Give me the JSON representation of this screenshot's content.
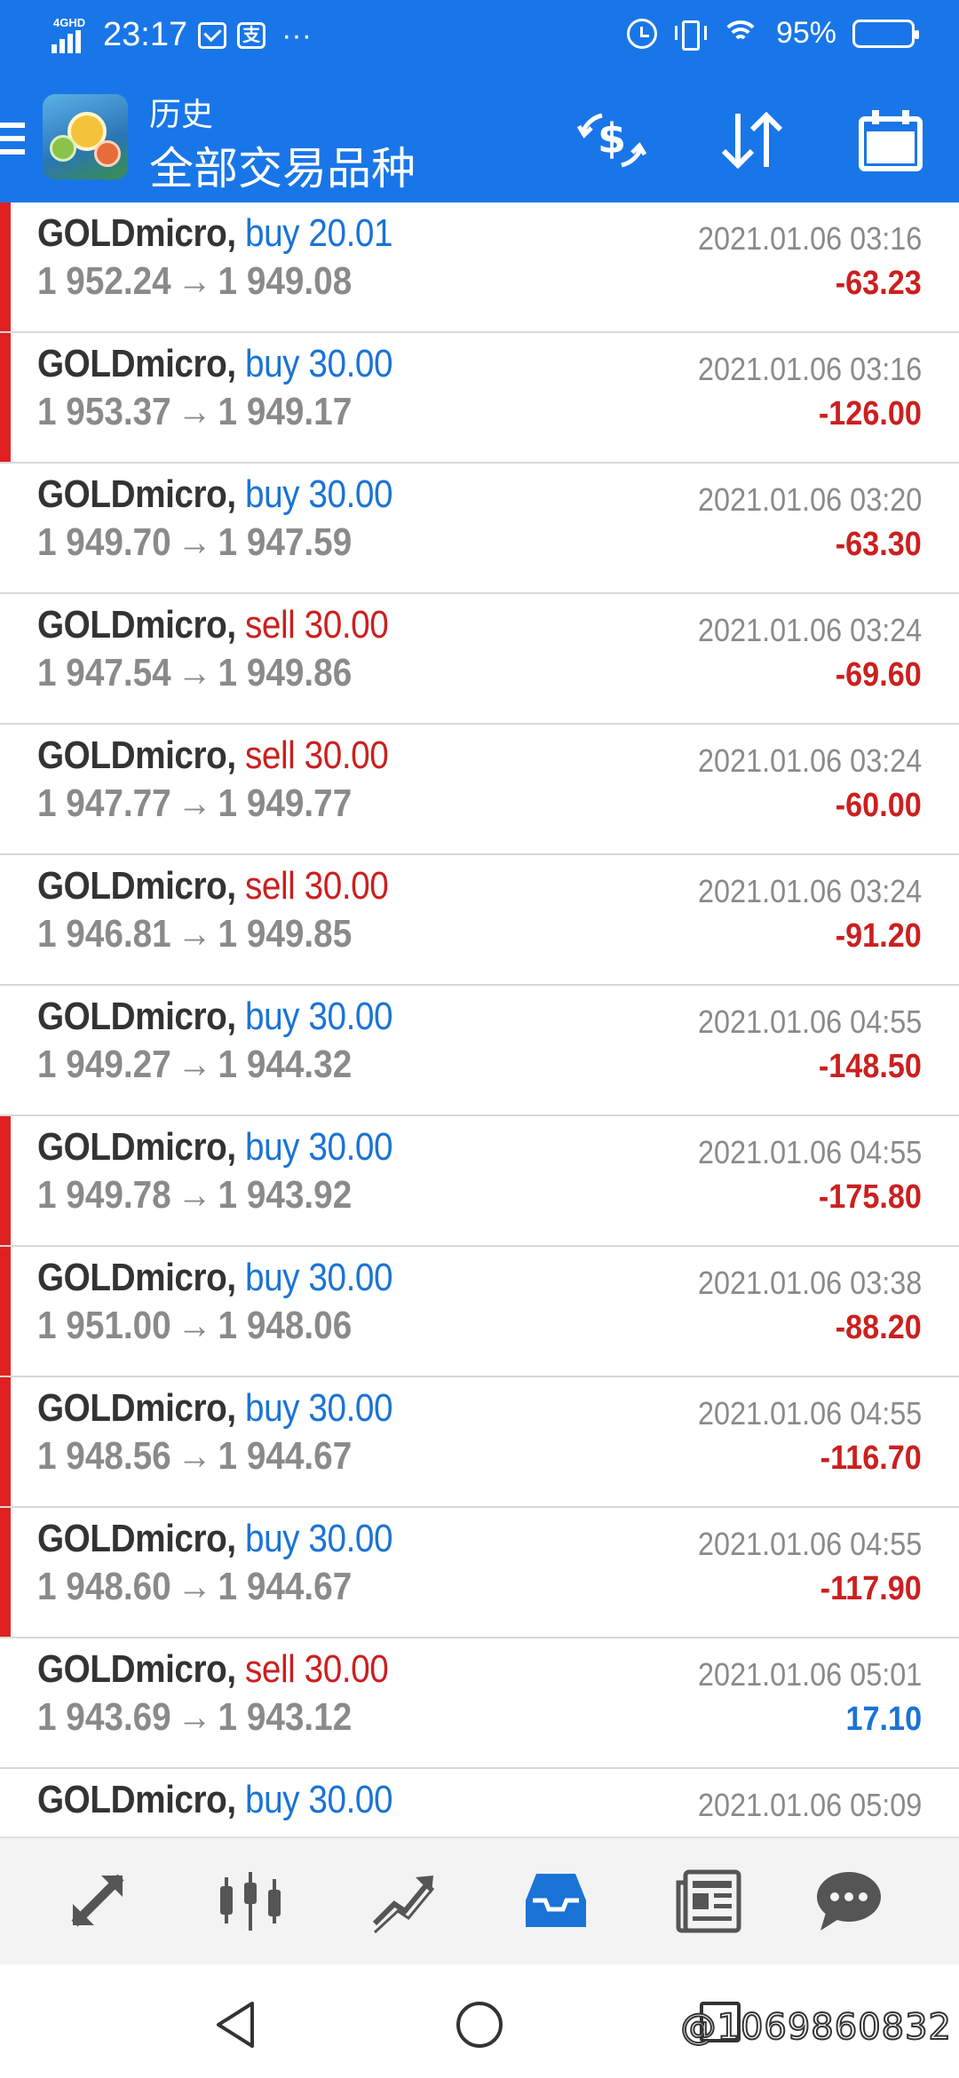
{
  "status_bar": {
    "network": "4GHD",
    "time": "23:17",
    "battery_pct": "95%",
    "battery_level": 0.95
  },
  "header": {
    "title_small": "历史",
    "title_big": "全部交易品种"
  },
  "colors": {
    "header_bg": "#1976e8",
    "buy": "#1a73d6",
    "sell": "#cc1f1f",
    "loss_flag": "#e02020"
  },
  "trades": [
    {
      "symbol": "GOLDmicro,",
      "type": "buy",
      "label": "buy 20.01",
      "open": "1 952.24",
      "close": "1 949.08",
      "time": "2021.01.06 03:16",
      "profit": "-63.23",
      "flag": true
    },
    {
      "symbol": "GOLDmicro,",
      "type": "buy",
      "label": "buy 30.00",
      "open": "1 953.37",
      "close": "1 949.17",
      "time": "2021.01.06 03:16",
      "profit": "-126.00",
      "flag": true
    },
    {
      "symbol": "GOLDmicro,",
      "type": "buy",
      "label": "buy 30.00",
      "open": "1 949.70",
      "close": "1 947.59",
      "time": "2021.01.06 03:20",
      "profit": "-63.30",
      "flag": false
    },
    {
      "symbol": "GOLDmicro,",
      "type": "sell",
      "label": "sell 30.00",
      "open": "1 947.54",
      "close": "1 949.86",
      "time": "2021.01.06 03:24",
      "profit": "-69.60",
      "flag": false
    },
    {
      "symbol": "GOLDmicro,",
      "type": "sell",
      "label": "sell 30.00",
      "open": "1 947.77",
      "close": "1 949.77",
      "time": "2021.01.06 03:24",
      "profit": "-60.00",
      "flag": false
    },
    {
      "symbol": "GOLDmicro,",
      "type": "sell",
      "label": "sell 30.00",
      "open": "1 946.81",
      "close": "1 949.85",
      "time": "2021.01.06 03:24",
      "profit": "-91.20",
      "flag": false
    },
    {
      "symbol": "GOLDmicro,",
      "type": "buy",
      "label": "buy 30.00",
      "open": "1 949.27",
      "close": "1 944.32",
      "time": "2021.01.06 04:55",
      "profit": "-148.50",
      "flag": false
    },
    {
      "symbol": "GOLDmicro,",
      "type": "buy",
      "label": "buy 30.00",
      "open": "1 949.78",
      "close": "1 943.92",
      "time": "2021.01.06 04:55",
      "profit": "-175.80",
      "flag": true
    },
    {
      "symbol": "GOLDmicro,",
      "type": "buy",
      "label": "buy 30.00",
      "open": "1 951.00",
      "close": "1 948.06",
      "time": "2021.01.06 03:38",
      "profit": "-88.20",
      "flag": true
    },
    {
      "symbol": "GOLDmicro,",
      "type": "buy",
      "label": "buy 30.00",
      "open": "1 948.56",
      "close": "1 944.67",
      "time": "2021.01.06 04:55",
      "profit": "-116.70",
      "flag": true
    },
    {
      "symbol": "GOLDmicro,",
      "type": "buy",
      "label": "buy 30.00",
      "open": "1 948.60",
      "close": "1 944.67",
      "time": "2021.01.06 04:55",
      "profit": "-117.90",
      "flag": true
    },
    {
      "symbol": "GOLDmicro,",
      "type": "sell",
      "label": "sell 30.00",
      "open": "1 943.69",
      "close": "1 943.12",
      "time": "2021.01.06 05:01",
      "profit": "17.10",
      "flag": false
    },
    {
      "symbol": "GOLDmicro,",
      "type": "buy",
      "label": "buy 30.00",
      "open": "",
      "close": "",
      "time": "2021.01.06 05:09",
      "profit": "",
      "flag": false
    }
  ],
  "arrow_glyph": "→",
  "bottom_nav": [
    {
      "name": "nav-quotes",
      "icon": "quotes-arrows-icon",
      "active": false
    },
    {
      "name": "nav-chart",
      "icon": "candlestick-icon",
      "active": false
    },
    {
      "name": "nav-trade",
      "icon": "trend-icon",
      "active": false
    },
    {
      "name": "nav-history",
      "icon": "inbox-icon",
      "active": true
    },
    {
      "name": "nav-news",
      "icon": "news-icon",
      "active": false
    },
    {
      "name": "nav-chat",
      "icon": "chat-bubble-icon",
      "active": false
    }
  ],
  "watermark": "@1069860832"
}
